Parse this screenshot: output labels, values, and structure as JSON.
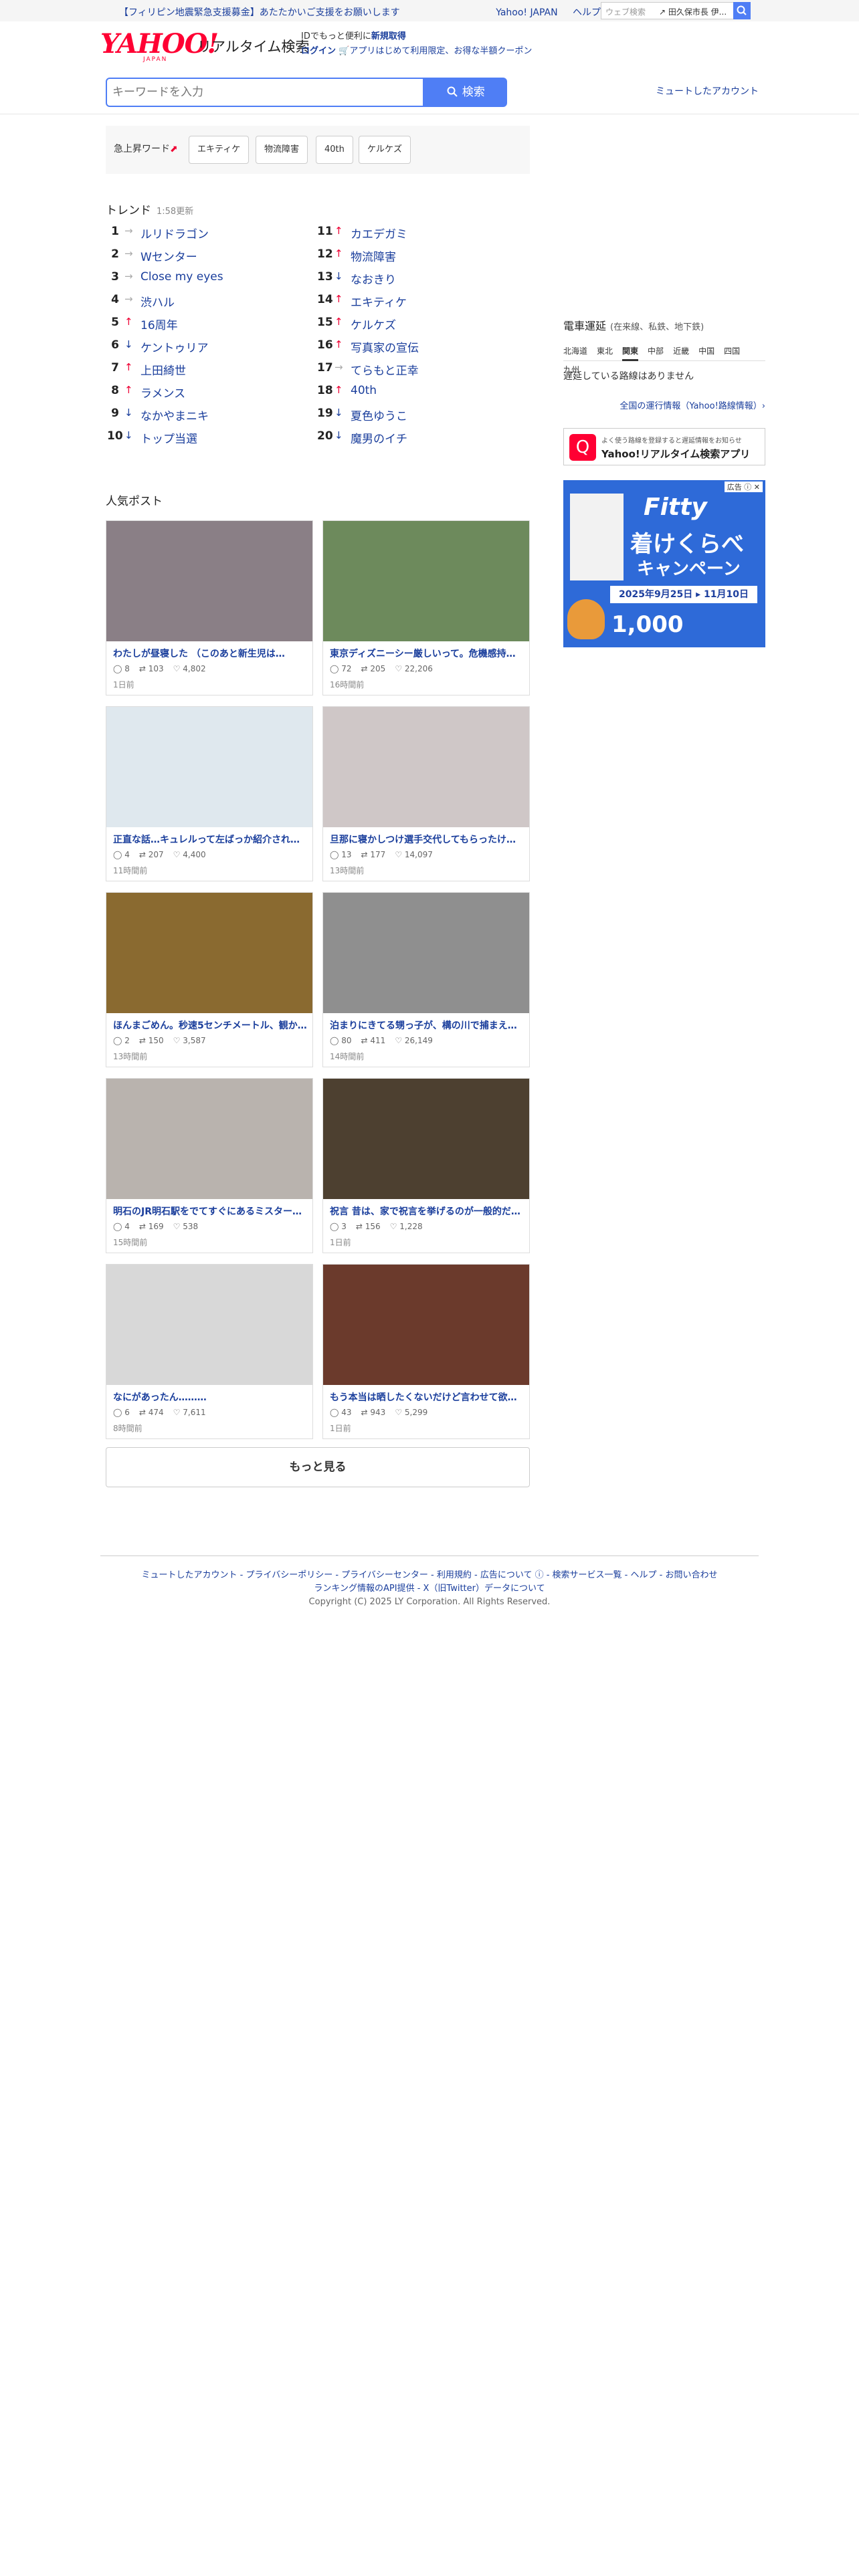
{
  "topbar": {
    "notice": "【フィリピン地震緊急支援募金】あたたかいご支援をお願いします",
    "links": [
      "Yahoo! JAPAN",
      "ヘルプ"
    ],
    "websearch_placeholder": "ウェブ検索",
    "websearch_suggestion": "↗ 田久保市長 伊..."
  },
  "header": {
    "logo_text": "YAHOO!",
    "logo_sub": "JAPAN",
    "service_name": "リアルタイム検索",
    "promo_line1_pre": "IDでもっと便利に",
    "promo_line1_link": "新規取得",
    "promo_line2_login": "ログイン",
    "promo_line2_rest": "🛒アプリはじめて利用限定、お得な半額クーポン",
    "search_placeholder": "キーワードを入力",
    "search_button": "検索",
    "mute_link": "ミュートしたアカウント"
  },
  "rising": {
    "label": "急上昇ワード",
    "words": [
      "エキティケ",
      "物流障害",
      "40th",
      "ケルケズ"
    ]
  },
  "trend": {
    "title": "トレンド",
    "updated": "1:58更新",
    "items": [
      {
        "rank": "1",
        "dir": "flat",
        "text": "ルリドラゴン"
      },
      {
        "rank": "2",
        "dir": "flat",
        "text": "Wセンター"
      },
      {
        "rank": "3",
        "dir": "flat",
        "text": "Close my eyes"
      },
      {
        "rank": "4",
        "dir": "flat",
        "text": "渋ハル"
      },
      {
        "rank": "5",
        "dir": "up",
        "text": "16周年"
      },
      {
        "rank": "6",
        "dir": "down",
        "text": "ケントゥリア"
      },
      {
        "rank": "7",
        "dir": "up",
        "text": "上田綺世"
      },
      {
        "rank": "8",
        "dir": "up",
        "text": "ラメンス"
      },
      {
        "rank": "9",
        "dir": "down",
        "text": "なかやまニキ"
      },
      {
        "rank": "10",
        "dir": "down",
        "text": "トップ当選"
      },
      {
        "rank": "11",
        "dir": "up",
        "text": "カエデガミ"
      },
      {
        "rank": "12",
        "dir": "up",
        "text": "物流障害"
      },
      {
        "rank": "13",
        "dir": "down",
        "text": "なおきり"
      },
      {
        "rank": "14",
        "dir": "up",
        "text": "エキティケ"
      },
      {
        "rank": "15",
        "dir": "up",
        "text": "ケルケズ"
      },
      {
        "rank": "16",
        "dir": "up",
        "text": "写真家の宣伝"
      },
      {
        "rank": "17",
        "dir": "flat",
        "text": "てらもと正幸"
      },
      {
        "rank": "18",
        "dir": "up",
        "text": "40th"
      },
      {
        "rank": "19",
        "dir": "down",
        "text": "夏色ゆうこ"
      },
      {
        "rank": "20",
        "dir": "down",
        "text": "魔男のイチ"
      }
    ]
  },
  "popular": {
    "title": "人気ポスト",
    "posts": [
      {
        "title": "わたしが昼寝した （このあと新生児は…",
        "replies": "8",
        "reposts": "103",
        "likes": "4,802",
        "ago": "1日前",
        "color": "#8a7f86"
      },
      {
        "title": "東京ディズニーシー厳しいって。危機感持…",
        "replies": "72",
        "reposts": "205",
        "likes": "22,206",
        "ago": "16時間前",
        "color": "#6d8a5c"
      },
      {
        "title": "正直な話…キュレルって左ばっか紹介され…",
        "replies": "4",
        "reposts": "207",
        "likes": "4,400",
        "ago": "11時間前",
        "color": "#dfe8ee"
      },
      {
        "title": "旦那に寝かしつけ選手交代してもらったけ…",
        "replies": "13",
        "reposts": "177",
        "likes": "14,097",
        "ago": "13時間前",
        "color": "#cfc7c7"
      },
      {
        "title": "ほんまごめん。秒速5センチメートル、観か…",
        "replies": "2",
        "reposts": "150",
        "likes": "3,587",
        "ago": "13時間前",
        "color": "#8a6a30"
      },
      {
        "title": "泊まりにきてる甥っ子が、構の川で捕まえ…",
        "replies": "80",
        "reposts": "411",
        "likes": "26,149",
        "ago": "14時間前",
        "color": "#8f8f8f"
      },
      {
        "title": "明石のJR明石駅をでてすぐにあるミスター…",
        "replies": "4",
        "reposts": "169",
        "likes": "538",
        "ago": "15時間前",
        "color": "#b9b3ae"
      },
      {
        "title": "祝言 昔は、家で祝言を挙げるのが一般的だ…",
        "replies": "3",
        "reposts": "156",
        "likes": "1,228",
        "ago": "1日前",
        "color": "#4d4030"
      },
      {
        "title": "なにがあったん………",
        "replies": "6",
        "reposts": "474",
        "likes": "7,611",
        "ago": "8時間前",
        "color": "#d8d8d8"
      },
      {
        "title": "もう本当は晒したくないだけど言わせて欲…",
        "replies": "43",
        "reposts": "943",
        "likes": "5,299",
        "ago": "1日前",
        "color": "#6b3a2c"
      }
    ],
    "more": "もっと見る"
  },
  "rail": {
    "title": "電車運延",
    "title_sub": "(在来線、私鉄、地下鉄)",
    "regions": [
      "北海道",
      "東北",
      "関東",
      "中部",
      "近畿",
      "中国",
      "四国",
      "九州"
    ],
    "active_region": "関東",
    "none_text": "遅延している路線はありません",
    "link": "全国の運行情報（Yahoo!路線情報）›"
  },
  "app": {
    "small": "よく使う路線を登録すると遅延情報をお知らせ",
    "big": "Yahoo!リアルタイム検索アプリ"
  },
  "ad": {
    "label": "広告 ⓘ ✕",
    "brand": "Fitty",
    "headline": "着けくらべ",
    "campaign": "キャンペーン",
    "dates": "2025年9月25日 ▸ 11月10日",
    "count": "1,000"
  },
  "footer": {
    "line1": "ミュートしたアカウント - プライバシーポリシー - プライバシーセンター - 利用規約 - 広告について ⓘ - 検索サービス一覧 - ヘルプ - お問い合わせ",
    "line2": "ランキング情報のAPI提供 - X（旧Twitter）データについて",
    "copyright": "Copyright (C) 2025 LY Corporation. All Rights Reserved."
  }
}
